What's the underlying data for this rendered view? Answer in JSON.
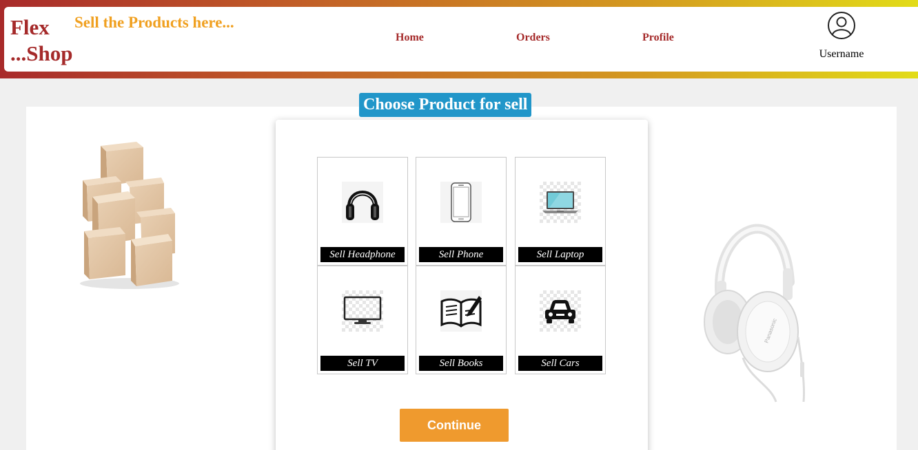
{
  "header": {
    "brand_line1": "Flex",
    "brand_line2": "...Shop",
    "tagline": "Sell the Products here...",
    "nav": {
      "home": "Home",
      "orders": "Orders",
      "profile": "Profile"
    },
    "username": "Username",
    "gradient_colors": [
      "#a82a2a",
      "#d49a20",
      "#e2dc18"
    ]
  },
  "main": {
    "title": "Choose Product for sell",
    "products": [
      {
        "label": "Sell Headphone",
        "icon": "headphone-icon"
      },
      {
        "label": "Sell Phone",
        "icon": "phone-icon"
      },
      {
        "label": "Sell Laptop",
        "icon": "laptop-icon"
      },
      {
        "label": "Sell TV",
        "icon": "tv-icon"
      },
      {
        "label": "Sell Books",
        "icon": "book-icon"
      },
      {
        "label": "Sell Cars",
        "icon": "car-icon"
      }
    ],
    "continue_label": "Continue"
  },
  "colors": {
    "brand": "#a52a2a",
    "tagline": "#f0a020",
    "title_badge": "#2196c9",
    "continue_button": "#ef9a2e"
  },
  "decorations": {
    "left_image": "cardboard-boxes-image",
    "right_image": "white-headphones-image"
  }
}
